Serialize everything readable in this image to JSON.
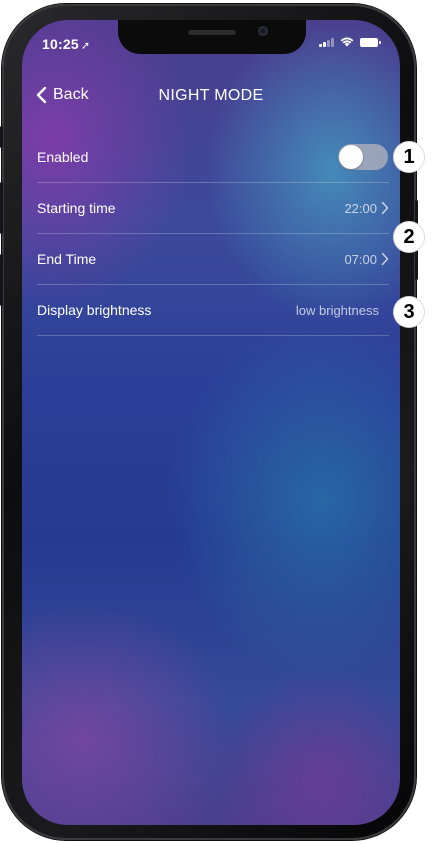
{
  "status_bar": {
    "time": "10:25",
    "location_icon": "location-arrow-icon",
    "signal_icon": "signal-icon",
    "wifi_icon": "wifi-icon",
    "battery_icon": "battery-icon"
  },
  "nav": {
    "back_label": "Back",
    "back_icon": "chevron-left-icon",
    "title": "NIGHT MODE"
  },
  "settings": {
    "enabled": {
      "label": "Enabled",
      "on": false
    },
    "starting_time": {
      "label": "Starting time",
      "value": "22:00"
    },
    "end_time": {
      "label": "End Time",
      "value": "07:00"
    },
    "display_brightness": {
      "label": "Display brightness",
      "value": "low brightness"
    }
  },
  "callouts": [
    "1",
    "2",
    "3"
  ],
  "colors": {
    "text": "#ffffff",
    "toggle_off": "#b4b4be",
    "callout_bg": "#ffffff",
    "callout_text": "#000000"
  }
}
